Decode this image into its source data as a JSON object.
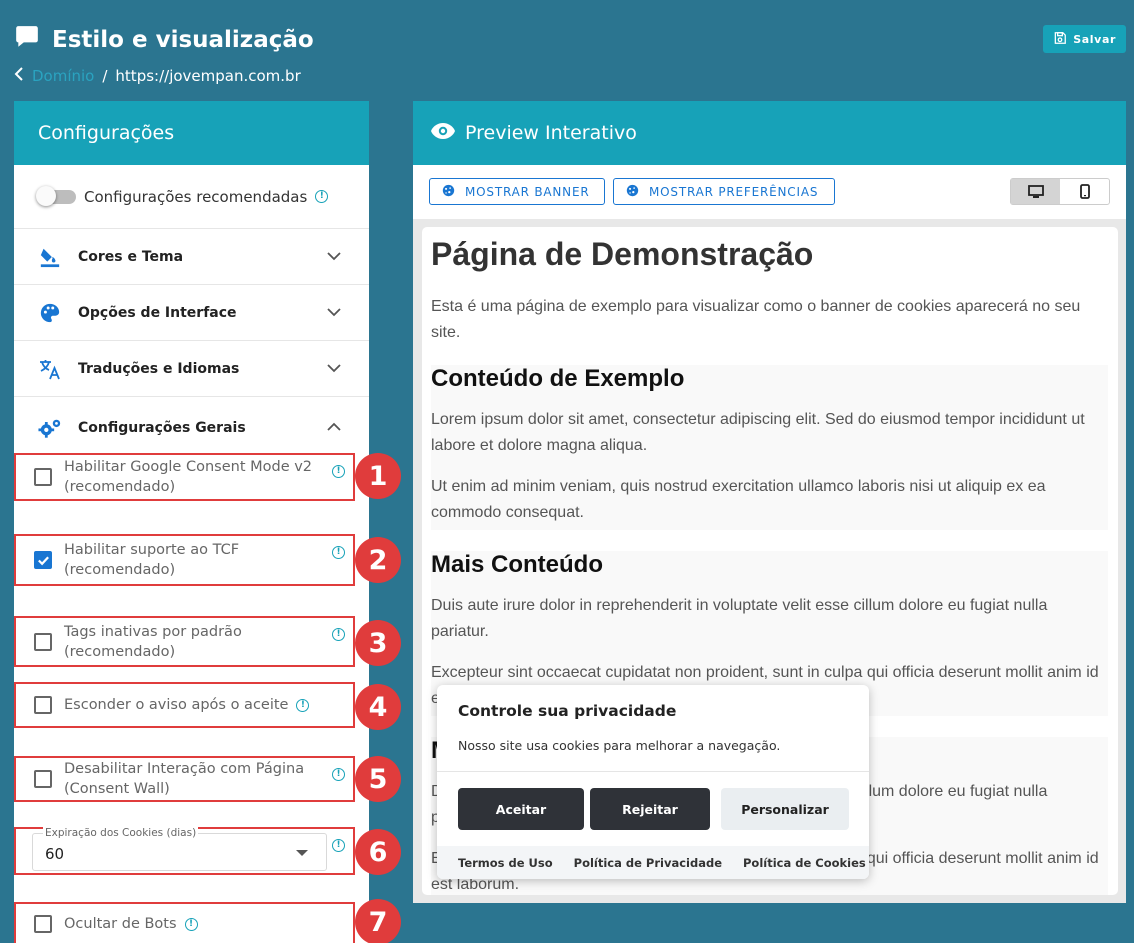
{
  "header": {
    "title": "Estilo e visualização",
    "save_label": "Salvar"
  },
  "breadcrumb": {
    "link": "Domínio",
    "separator": "/",
    "current": "https://jovempan.com.br"
  },
  "config": {
    "title": "Configurações",
    "recommended_label": "Configurações recomendadas",
    "accordions": [
      {
        "label": "Cores e Tema",
        "icon": "paint-bucket-icon"
      },
      {
        "label": "Opções de Interface",
        "icon": "palette-icon"
      },
      {
        "label": "Traduções e Idiomas",
        "icon": "translate-icon"
      },
      {
        "label": "Configurações Gerais",
        "icon": "gears-icon"
      }
    ],
    "options": [
      {
        "line1": "Habilitar Google Consent Mode v2",
        "line2": "(recomendado)",
        "checked": false,
        "badge": "1"
      },
      {
        "line1": "Habilitar suporte ao TCF",
        "line2": "(recomendado)",
        "checked": true,
        "badge": "2"
      },
      {
        "line1": "Tags inativas por padrão",
        "line2": "(recomendado)",
        "checked": false,
        "badge": "3"
      },
      {
        "line1": "Esconder o aviso após o aceite",
        "checked": false,
        "badge": "4"
      },
      {
        "line1": "Desabilitar Interação com Página",
        "line2": "(Consent Wall)",
        "checked": false,
        "badge": "5"
      },
      {
        "select_label": "Expiração dos Cookies (dias)",
        "select_value": "60",
        "badge": "6"
      },
      {
        "line1": "Ocultar de Bots",
        "checked": false,
        "badge": "7"
      }
    ],
    "info_glyph": "!"
  },
  "preview": {
    "title": "Preview Interativo",
    "show_banner": "MOSTRAR BANNER",
    "show_preferences": "MOSTRAR PREFERÊNCIAS",
    "demo": {
      "h1": "Página de Demonstração",
      "intro": "Esta é uma página de exemplo para visualizar como o banner de cookies aparecerá no seu site.",
      "section1_title": "Conteúdo de Exemplo",
      "section1_p1": "Lorem ipsum dolor sit amet, consectetur adipiscing elit. Sed do eiusmod tempor incididunt ut labore et dolore magna aliqua.",
      "section1_p2": "Ut enim ad minim veniam, quis nostrud exercitation ullamco laboris nisi ut aliquip ex ea commodo consequat.",
      "section2_title": "Mais Conteúdo",
      "section2_p1": "Duis aute irure dolor in reprehenderit in voluptate velit esse cillum dolore eu fugiat nulla pariatur.",
      "section2_p2": "Excepteur sint occaecat cupidatat non proident, sunt in culpa qui officia deserunt mollit anim id est laborum.",
      "section3_title": "Mais Conteúdo",
      "section3_p1": "Duis aute irure dolor in reprehenderit in voluptate velit esse cillum dolore eu fugiat nulla pariatur.",
      "section3_p2": "Excepteur sint occaecat cupidatat non proident, sunt in culpa qui officia deserunt mollit anim id est laborum."
    },
    "banner": {
      "title": "Controle sua privacidade",
      "text": "Nosso site usa cookies para melhorar a navegação.",
      "accept": "Aceitar",
      "reject": "Rejeitar",
      "customize": "Personalizar",
      "links": [
        "Termos de Uso",
        "Política de Privacidade",
        "Política de Cookies"
      ]
    }
  },
  "colors": {
    "background": "#2b7590",
    "accent": "#17a2b8",
    "highlight": "#e03c3c",
    "checkbox": "#1976d2"
  }
}
